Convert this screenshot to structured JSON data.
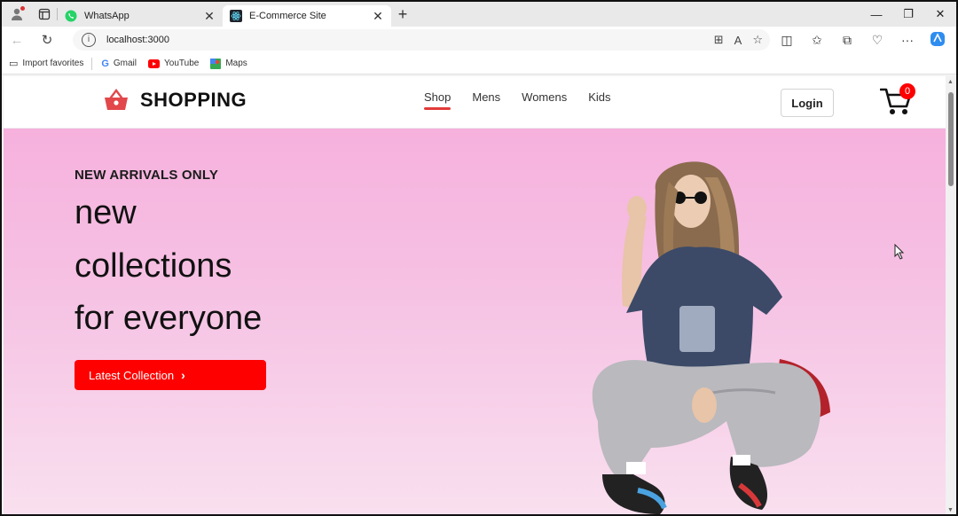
{
  "browser": {
    "tabs": [
      {
        "title": "WhatsApp",
        "icon": "whatsapp-icon",
        "active": false
      },
      {
        "title": "E-Commerce Site",
        "icon": "react-icon",
        "active": true
      }
    ],
    "url": "localhost:3000",
    "favorites": [
      {
        "label": "Import favorites",
        "icon": "import-icon"
      },
      {
        "label": "Gmail",
        "icon": "google-icon"
      },
      {
        "label": "YouTube",
        "icon": "youtube-icon"
      },
      {
        "label": "Maps",
        "icon": "maps-icon"
      }
    ]
  },
  "site": {
    "brand": "SHOPPING",
    "menu": [
      "Shop",
      "Mens",
      "Womens",
      "Kids"
    ],
    "active_menu": "Shop",
    "login_label": "Login",
    "cart_count": "0"
  },
  "hero": {
    "eyebrow": "NEW ARRIVALS ONLY",
    "line1": "new",
    "line2": "collections",
    "line3": "for everyone",
    "cta_label": "Latest Collection"
  },
  "colors": {
    "accent": "#ff0000",
    "hero_top": "#f6b1dd",
    "hero_bottom": "#f9e0ef"
  }
}
